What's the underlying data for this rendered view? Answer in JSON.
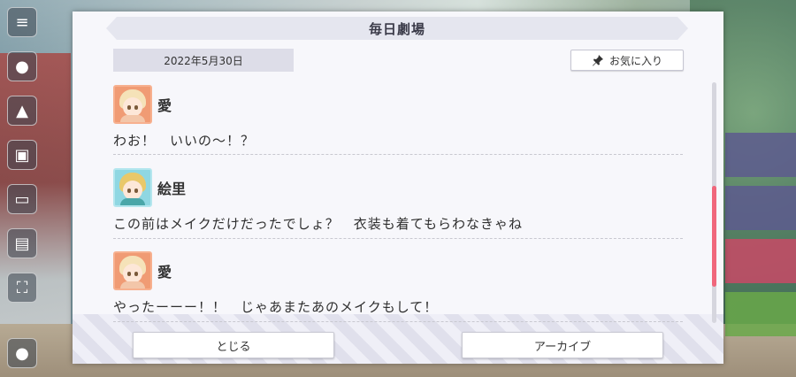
{
  "dialog": {
    "title": "毎日劇場",
    "date": "2022年5月30日",
    "favorite_label": "お気に入り",
    "close_label": "とじる",
    "archive_label": "アーカイブ"
  },
  "entries": [
    {
      "name": "愛",
      "text": "わお！　いいの〜！？"
    },
    {
      "name": "絵里",
      "text": "この前はメイクだけだったでしょ？　衣装も着てもらわなきゃね"
    },
    {
      "name": "愛",
      "text": "やったーーー！！　じゃあまたあのメイクもして！"
    }
  ],
  "colors": {
    "scroll_thumb": "#f0667b",
    "avatar_ai": "#f09b74",
    "avatar_eri": "#8fd7e2"
  }
}
